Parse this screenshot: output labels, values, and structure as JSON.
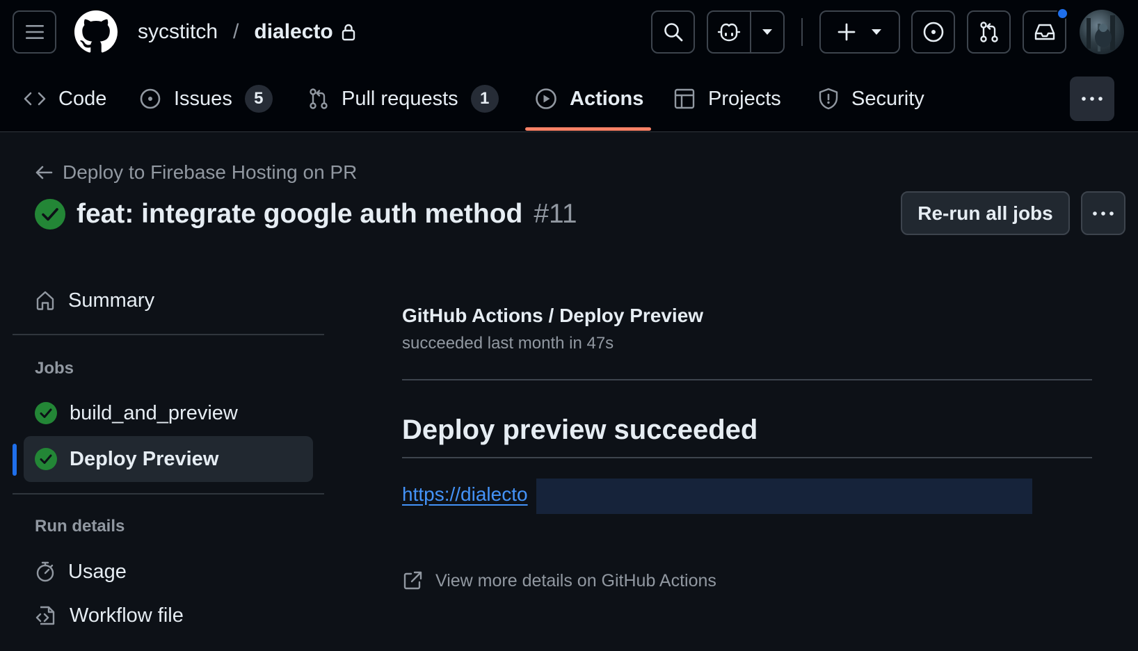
{
  "header": {
    "owner": "sycstitch",
    "separator": "/",
    "repo": "dialecto",
    "has_notification": true
  },
  "tabs": [
    {
      "label": "Code",
      "count": null
    },
    {
      "label": "Issues",
      "count": "5"
    },
    {
      "label": "Pull requests",
      "count": "1"
    },
    {
      "label": "Actions",
      "count": null,
      "active": true
    },
    {
      "label": "Projects",
      "count": null
    },
    {
      "label": "Security",
      "count": null
    }
  ],
  "run": {
    "workflow_name": "Deploy to Firebase Hosting on PR",
    "title": "feat: integrate google auth method",
    "number": "#11",
    "status": "success",
    "rerun_label": "Re-run all jobs"
  },
  "sidebar": {
    "summary_label": "Summary",
    "jobs_heading": "Jobs",
    "jobs": [
      {
        "label": "build_and_preview",
        "status": "success"
      },
      {
        "label": "Deploy Preview",
        "status": "success",
        "selected": true
      }
    ],
    "run_details_heading": "Run details",
    "run_details": [
      {
        "label": "Usage",
        "icon": "stopwatch-icon"
      },
      {
        "label": "Workflow file",
        "icon": "file-code-icon"
      }
    ]
  },
  "check_run": {
    "title": "GitHub Actions / Deploy Preview",
    "subtitle": "succeeded last month in 47s",
    "summary_heading": "Deploy preview succeeded",
    "preview_url": "https://dialecto",
    "view_more": "View more details on GitHub Actions"
  },
  "colors": {
    "accent_underline": "#f78166",
    "success": "#238636",
    "link": "#4493f8",
    "notification": "#1f6feb"
  }
}
